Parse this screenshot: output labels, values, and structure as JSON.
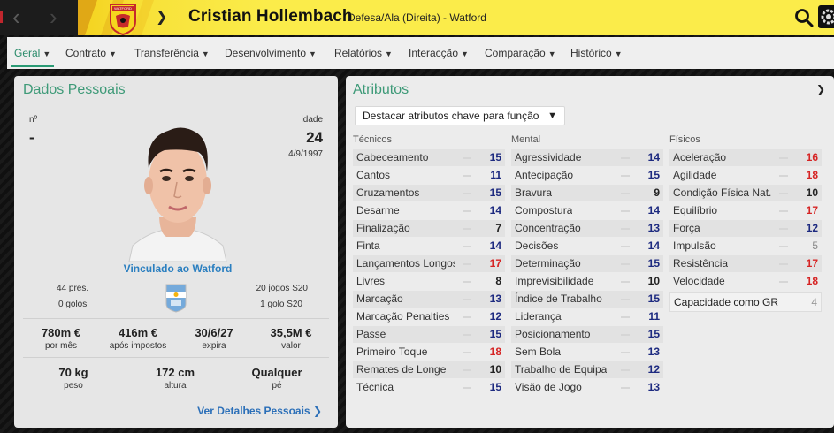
{
  "header": {
    "player_name": "Cristian Hollembach",
    "player_subtitle": "Defesa/Ala (Direita) - Watford",
    "crest_text": "WATFORD",
    "colors": {
      "banner": "#fbec4a",
      "accent": "#2a9a74",
      "link": "#2b6fb8"
    }
  },
  "tabs": [
    {
      "label": "Geral",
      "active": true
    },
    {
      "label": "Contrato"
    },
    {
      "label": "Transferência"
    },
    {
      "label": "Desenvolvimento"
    },
    {
      "label": "Relatórios"
    },
    {
      "label": "Interacção"
    },
    {
      "label": "Comparação"
    },
    {
      "label": "Histórico"
    }
  ],
  "personal": {
    "title": "Dados Pessoais",
    "number_label": "nº",
    "number_value": "-",
    "age_label": "idade",
    "age_value": "24",
    "birth_date": "4/9/1997",
    "contract_text": "Vinculado ao Watford",
    "caps": "44 pres.",
    "goals": "0 golos",
    "u20_games": "20 jogos S20",
    "u20_goals": "1 golo S20",
    "wage_value": "780m €",
    "wage_label": "por mês",
    "after_tax_value": "416m €",
    "after_tax_label": "após impostos",
    "expires_value": "30/6/27",
    "expires_label": "expira",
    "worth_value": "35,5M €",
    "worth_label": "valor",
    "weight_value": "70 kg",
    "weight_label": "peso",
    "height_value": "172 cm",
    "height_label": "altura",
    "foot_value": "Qualquer",
    "foot_label": "pé",
    "more_link": "Ver Detalhes Pessoais"
  },
  "attributes": {
    "title": "Atributos",
    "highlight_dropdown": "Destacar atributos chave para função",
    "columns": [
      {
        "heading": "Técnicos",
        "rows": [
          {
            "name": "Cabeceamento",
            "value": "15",
            "color": "blue"
          },
          {
            "name": "Cantos",
            "value": "11",
            "color": "blue"
          },
          {
            "name": "Cruzamentos",
            "value": "15",
            "color": "blue"
          },
          {
            "name": "Desarme",
            "value": "14",
            "color": "blue"
          },
          {
            "name": "Finalização",
            "value": "7",
            "color": "black"
          },
          {
            "name": "Finta",
            "value": "14",
            "color": "blue"
          },
          {
            "name": "Lançamentos Longos",
            "value": "17",
            "color": "red"
          },
          {
            "name": "Livres",
            "value": "8",
            "color": "black"
          },
          {
            "name": "Marcação",
            "value": "13",
            "color": "blue"
          },
          {
            "name": "Marcação Penalties",
            "value": "12",
            "color": "blue"
          },
          {
            "name": "Passe",
            "value": "15",
            "color": "blue"
          },
          {
            "name": "Primeiro Toque",
            "value": "18",
            "color": "red"
          },
          {
            "name": "Remates de Longe",
            "value": "10",
            "color": "black"
          },
          {
            "name": "Técnica",
            "value": "15",
            "color": "blue"
          }
        ]
      },
      {
        "heading": "Mental",
        "rows": [
          {
            "name": "Agressividade",
            "value": "14",
            "color": "blue"
          },
          {
            "name": "Antecipação",
            "value": "15",
            "color": "blue"
          },
          {
            "name": "Bravura",
            "value": "9",
            "color": "black"
          },
          {
            "name": "Compostura",
            "value": "14",
            "color": "blue"
          },
          {
            "name": "Concentração",
            "value": "13",
            "color": "blue"
          },
          {
            "name": "Decisões",
            "value": "14",
            "color": "blue"
          },
          {
            "name": "Determinação",
            "value": "15",
            "color": "blue"
          },
          {
            "name": "Imprevisibilidade",
            "value": "10",
            "color": "black"
          },
          {
            "name": "Índice de Trabalho",
            "value": "15",
            "color": "blue"
          },
          {
            "name": "Liderança",
            "value": "11",
            "color": "blue"
          },
          {
            "name": "Posicionamento",
            "value": "15",
            "color": "blue"
          },
          {
            "name": "Sem Bola",
            "value": "13",
            "color": "blue"
          },
          {
            "name": "Trabalho de Equipa",
            "value": "12",
            "color": "blue"
          },
          {
            "name": "Visão de Jogo",
            "value": "13",
            "color": "blue"
          }
        ]
      },
      {
        "heading": "Físicos",
        "rows": [
          {
            "name": "Aceleração",
            "value": "16",
            "color": "red"
          },
          {
            "name": "Agilidade",
            "value": "18",
            "color": "red"
          },
          {
            "name": "Condição Física Nat...",
            "value": "10",
            "color": "black"
          },
          {
            "name": "Equilíbrio",
            "value": "17",
            "color": "red"
          },
          {
            "name": "Força",
            "value": "12",
            "color": "blue"
          },
          {
            "name": "Impulsão",
            "value": "5",
            "color": "grey"
          },
          {
            "name": "Resistência",
            "value": "17",
            "color": "red"
          },
          {
            "name": "Velocidade",
            "value": "18",
            "color": "red"
          }
        ]
      }
    ],
    "goalkeeping": {
      "name": "Capacidade como GR",
      "value": "4"
    }
  },
  "icons": [
    "back-arrow-icon",
    "forward-arrow-icon",
    "club-crest-icon",
    "chevron-down-icon",
    "search-icon",
    "settings-icon",
    "argentina-flag-icon",
    "chevron-right-icon"
  ]
}
